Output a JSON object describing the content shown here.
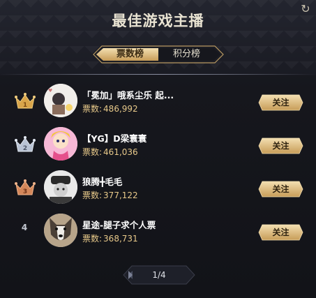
{
  "header": {
    "title": "最佳游戏主播"
  },
  "tabs": [
    {
      "label": "票数榜",
      "active": true
    },
    {
      "label": "积分榜",
      "active": false
    }
  ],
  "rows": [
    {
      "rank": "1",
      "name": "「冕加」哦系尘乐 起...",
      "votes_label": "票数:",
      "votes": "486,992",
      "follow": "关注"
    },
    {
      "rank": "2",
      "name": "【YG】D梁寰寰",
      "votes_label": "票数:",
      "votes": "461,036",
      "follow": "关注"
    },
    {
      "rank": "3",
      "name": "狼腾╋毛毛",
      "votes_label": "票数:",
      "votes": "377,122",
      "follow": "关注"
    },
    {
      "rank": "4",
      "name": "星途-腿子求个人票",
      "votes_label": "票数:",
      "votes": "368,731",
      "follow": "关注"
    }
  ],
  "pager": {
    "label": "1/4"
  },
  "colors": {
    "gold": "#e8c98a",
    "crown_gold": "#d9a54a",
    "crown_silver": "#b9c3d4",
    "crown_bronze": "#d4875a"
  }
}
